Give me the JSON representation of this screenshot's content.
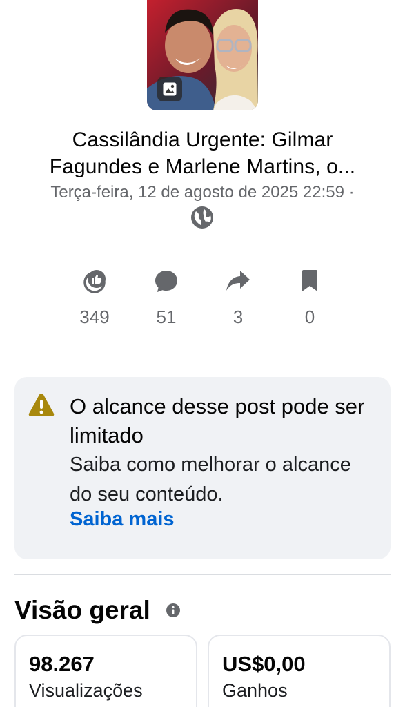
{
  "post": {
    "thumbnail": "post-photo",
    "thumbnail_badge_icon": "image-icon",
    "title_line1": "Cassilândia Urgente: Gilmar",
    "title_line2": "Fagundes e Marlene Martins, o...",
    "date": "Terça-feira, 12 de agosto de 2025 22:59 ·",
    "privacy_icon": "globe-icon"
  },
  "stats": [
    {
      "icon": "reactions-icon",
      "value": "349"
    },
    {
      "icon": "comment-icon",
      "value": "51"
    },
    {
      "icon": "share-icon",
      "value": "3"
    },
    {
      "icon": "bookmark-icon",
      "value": "0"
    }
  ],
  "alert": {
    "icon": "warning-icon",
    "title": "O alcance desse post pode ser limitado",
    "body": "Saiba como melhorar o alcance do seu conteúdo.",
    "link": "Saiba mais"
  },
  "overview": {
    "title": "Visão geral",
    "info_icon": "info-icon",
    "metrics": [
      {
        "value": "98.267",
        "label": "Visualizações"
      },
      {
        "value": "US$0,00",
        "label": "Ganhos"
      }
    ]
  },
  "colors": {
    "text_primary": "#050505",
    "text_secondary": "#65676b",
    "link": "#0064d1",
    "card_bg": "#f0f2f5",
    "warning": "#b8860b"
  }
}
